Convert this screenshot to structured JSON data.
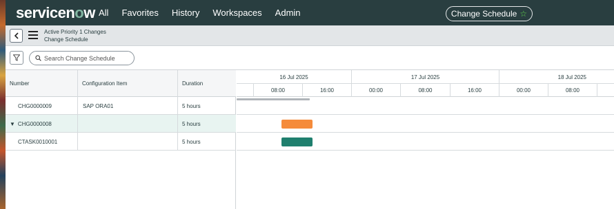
{
  "brand": {
    "logo_pre": "servicen",
    "logo_o": "o",
    "logo_post": "w"
  },
  "nav": {
    "links": [
      "All",
      "Favorites",
      "History",
      "Workspaces",
      "Admin"
    ],
    "pill_label": "Change Schedule",
    "pill_icon": "star-icon"
  },
  "breadcrumb": {
    "line1": "Active Priority 1 Changes",
    "line2": "Change Schedule"
  },
  "toolbar": {
    "search_placeholder": "Search Change Schedule"
  },
  "grid": {
    "columns": [
      "Number",
      "Configuration Item",
      "Duration"
    ],
    "rows": [
      {
        "number": "CHG0000009",
        "ci": "SAP ORA01",
        "duration": "5 hours",
        "expander": ""
      },
      {
        "number": "CHG0000008",
        "ci": "",
        "duration": "5 hours",
        "expander": "▼"
      },
      {
        "number": "CTASK0010001",
        "ci": "",
        "duration": "5 hours",
        "expander": ""
      }
    ]
  },
  "timeline": {
    "days": [
      "16 Jul 2025",
      "17 Jul 2025",
      "18 Jul 2025"
    ],
    "hours": [
      "08:00",
      "16:00",
      "00:00",
      "08:00",
      "16:00",
      "00:00",
      "08:00"
    ],
    "bars": [
      {
        "row": 1,
        "color": "#f58b3b"
      },
      {
        "row": 2,
        "color": "#1f7f6e"
      }
    ]
  },
  "colors": {
    "header_bg": "#293e40",
    "accent_green": "#62d84e",
    "change_bar": "#f58b3b",
    "task_bar": "#1f7f6e"
  }
}
